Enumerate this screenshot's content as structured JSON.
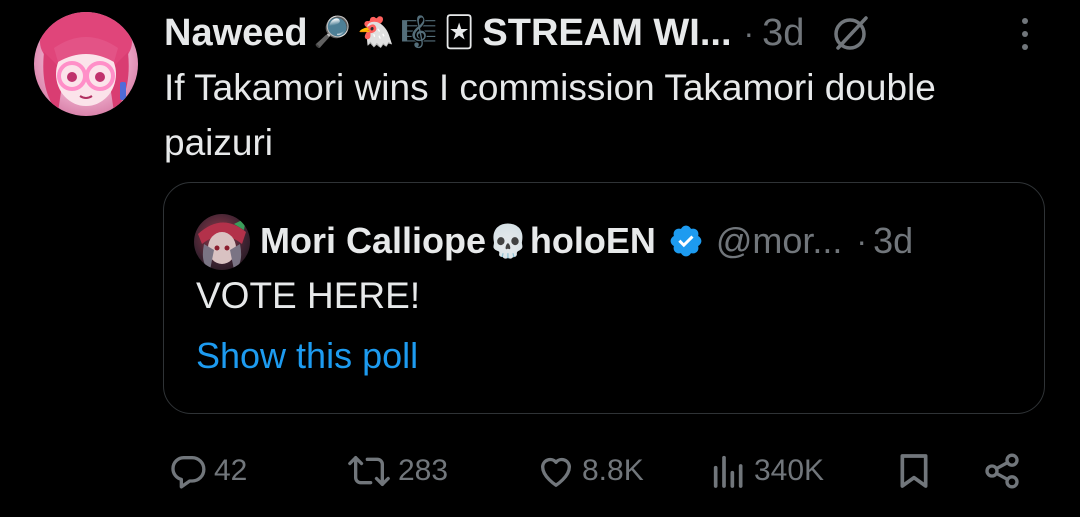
{
  "tweet": {
    "author_name": "Naweed",
    "name_emojis": [
      "🔎",
      "🐔",
      "🎼",
      "🃏"
    ],
    "author_suffix": "STREAM WI...",
    "time": "3d",
    "text": "If Takamori wins I commission Takamori double paizuri"
  },
  "quote": {
    "author_name": "Mori Calliope",
    "name_emoji": "💀",
    "author_suffix": "holoEN",
    "handle": "@mor...",
    "time": "3d",
    "text": "VOTE HERE!",
    "poll_link": "Show this poll"
  },
  "actions": {
    "replies": "42",
    "reposts": "283",
    "likes": "8.8K",
    "views": "340K"
  },
  "colors": {
    "background": "#000000",
    "text": "#e7e9ea",
    "secondary": "#71767b",
    "link": "#1d9bf0",
    "border": "#2f3336"
  }
}
